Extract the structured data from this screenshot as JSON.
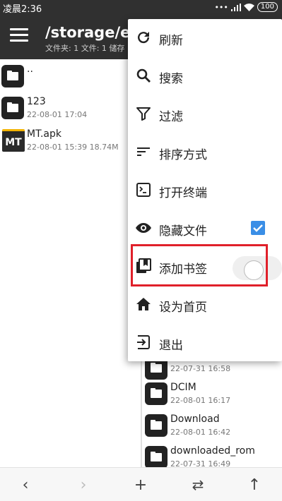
{
  "status_bar": {
    "time": "凌晨2:36",
    "battery": "100"
  },
  "header": {
    "path": "/storage/emu",
    "info": "文件夹: 1  文件: 1  储存"
  },
  "left_pane": {
    "items": [
      {
        "name": "..",
        "meta": ""
      },
      {
        "name": "123",
        "meta": "22-08-01 17:04"
      },
      {
        "name": "MT.apk",
        "meta": "22-08-01 15:39  18.74M",
        "icon_text": "MT"
      }
    ]
  },
  "right_pane": {
    "items": [
      {
        "name": "",
        "meta": "22-07-31 16:58"
      },
      {
        "name": "DCIM",
        "meta": "22-08-01 16:17"
      },
      {
        "name": "Download",
        "meta": "22-08-01 16:42"
      },
      {
        "name": "downloaded_rom",
        "meta": "22-07-31 16:49"
      }
    ]
  },
  "menu": {
    "items": [
      {
        "label": "刷新",
        "icon": "refresh-icon"
      },
      {
        "label": "搜索",
        "icon": "search-icon"
      },
      {
        "label": "过滤",
        "icon": "filter-icon"
      },
      {
        "label": "排序方式",
        "icon": "sort-icon"
      },
      {
        "label": "打开终端",
        "icon": "terminal-icon"
      },
      {
        "label": "隐藏文件",
        "icon": "eye-icon",
        "checked": true
      },
      {
        "label": "添加书签",
        "icon": "bookmark-icon",
        "toggle": false
      },
      {
        "label": "设为首页",
        "icon": "home-icon"
      },
      {
        "label": "退出",
        "icon": "exit-icon"
      }
    ]
  },
  "bottom_bar": {
    "buttons": [
      "back-icon",
      "forward-icon",
      "add-icon",
      "swap-icon",
      "up-icon"
    ]
  },
  "colors": {
    "header": "#303030",
    "checkbox": "#3a8ee6",
    "highlight": "#e0202a"
  }
}
